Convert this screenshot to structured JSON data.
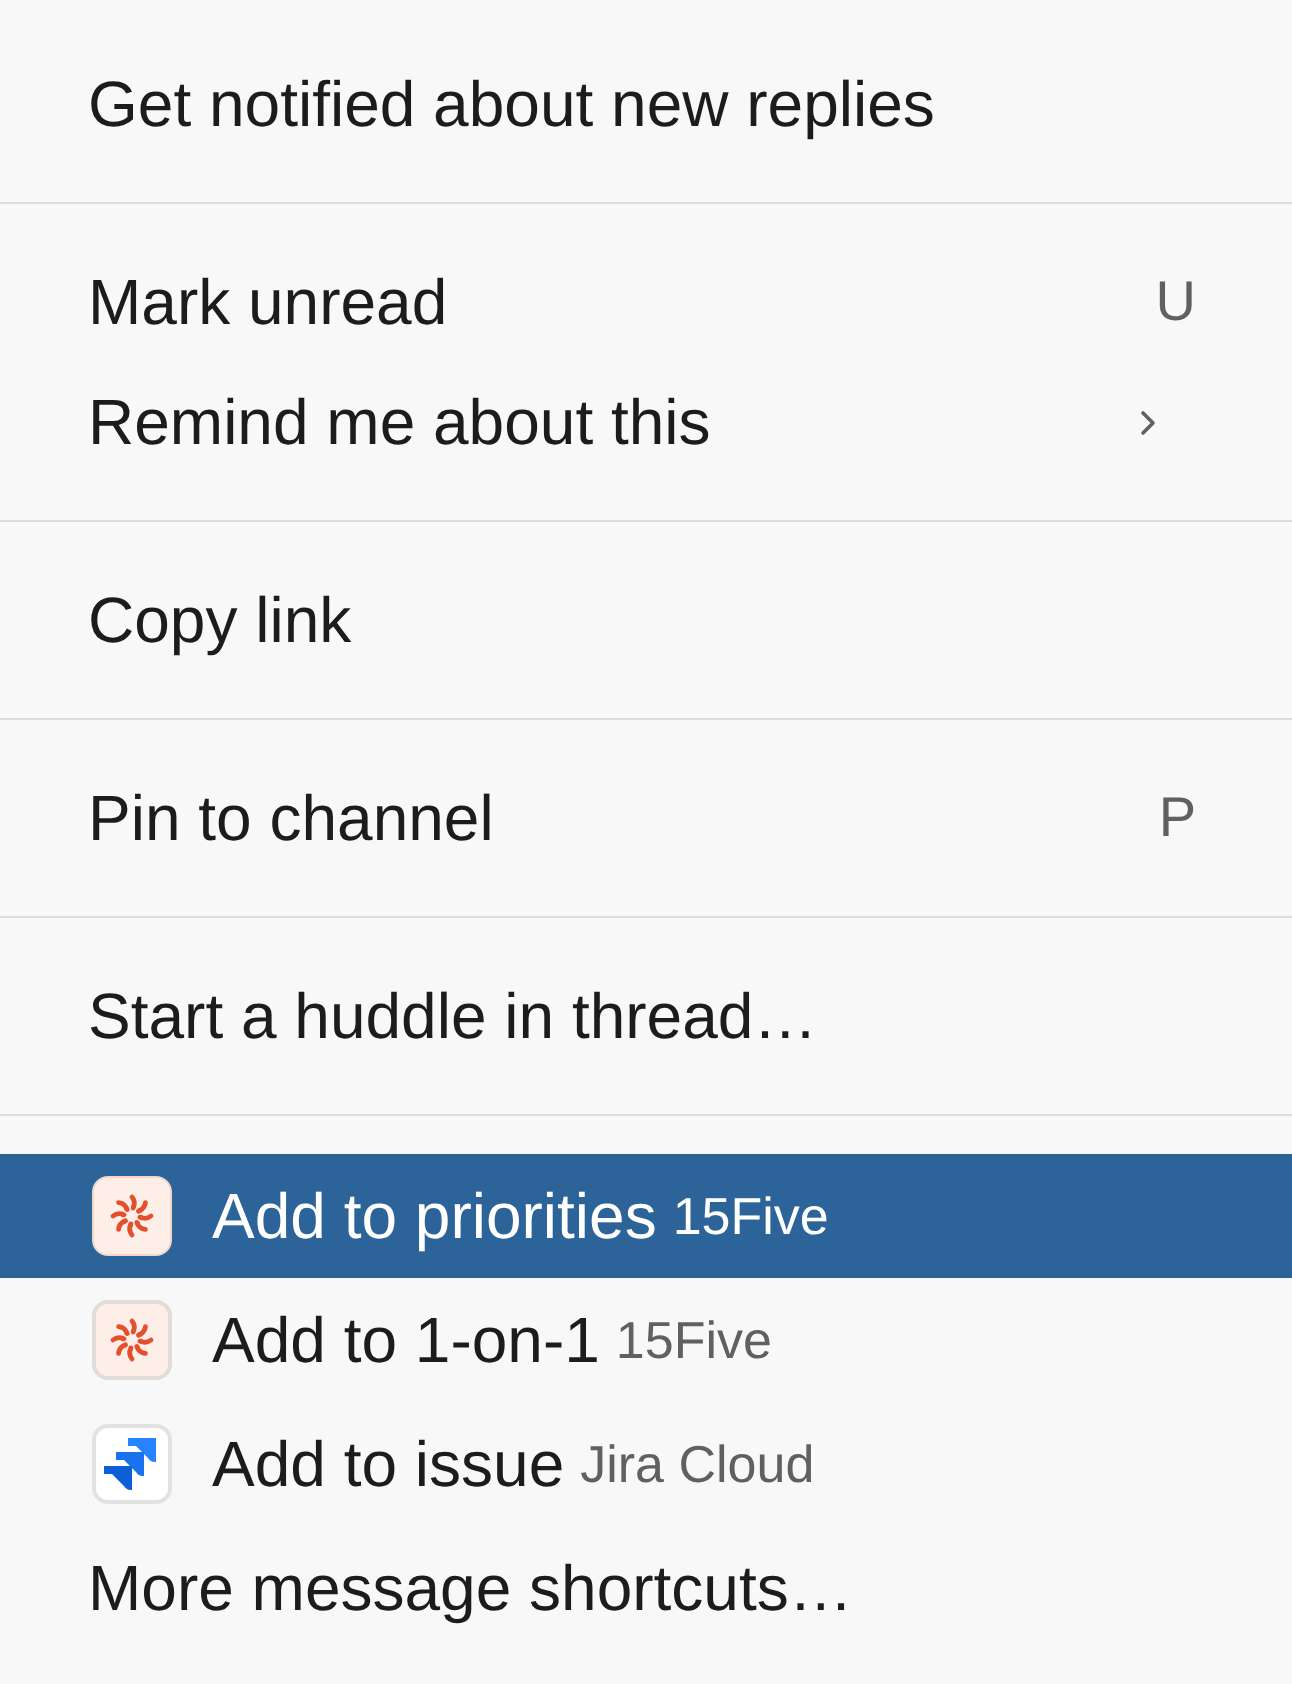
{
  "menu": {
    "sections": [
      {
        "items": [
          {
            "kind": "plain",
            "label": "Get notified about new replies",
            "selected": false
          }
        ]
      },
      {
        "items": [
          {
            "kind": "shortcut",
            "label": "Mark unread",
            "shortcut": "U",
            "selected": false
          },
          {
            "kind": "submenu",
            "label": "Remind me about this",
            "selected": false
          }
        ]
      },
      {
        "items": [
          {
            "kind": "plain",
            "label": "Copy link",
            "selected": false
          }
        ]
      },
      {
        "items": [
          {
            "kind": "shortcut",
            "label": "Pin to channel",
            "shortcut": "P",
            "selected": false
          }
        ]
      },
      {
        "items": [
          {
            "kind": "plain",
            "label": "Start a huddle in thread…",
            "selected": false
          }
        ]
      },
      {
        "items": [
          {
            "kind": "app_burst",
            "label": "Add to priorities",
            "app_name": "15Five",
            "selected": true
          },
          {
            "kind": "app_burst",
            "label": "Add to 1-on-1",
            "app_name": "15Five",
            "selected": false
          },
          {
            "kind": "app_blocks",
            "label": "Add to issue",
            "app_name": "Jira Cloud",
            "selected": false
          },
          {
            "kind": "plain",
            "label": "More message shortcuts…",
            "selected": false
          }
        ]
      }
    ]
  }
}
